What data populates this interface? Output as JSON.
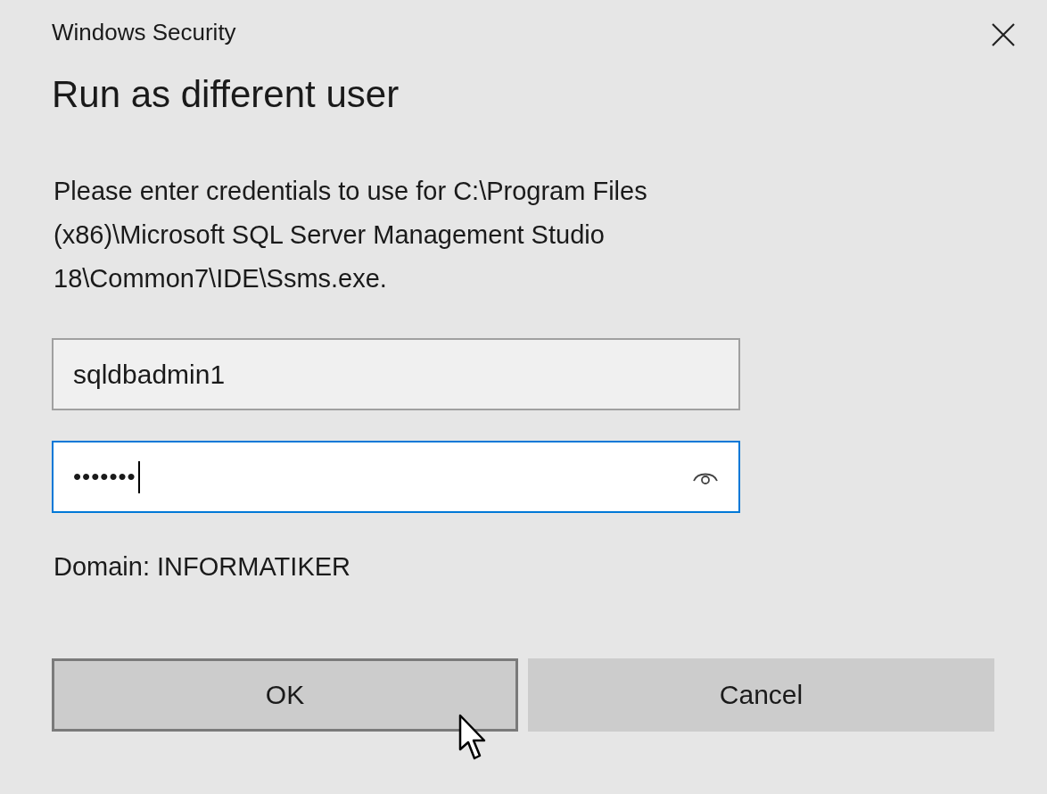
{
  "window": {
    "title": "Windows Security"
  },
  "heading": "Run as different user",
  "message": "Please enter credentials to use for C:\\Program Files (x86)\\Microsoft SQL Server Management Studio 18\\Common7\\IDE\\Ssms.exe.",
  "username": {
    "value": "sqldbadmin1",
    "focused": false
  },
  "password": {
    "value": "•••••••",
    "focused": true
  },
  "domain": "Domain: INFORMATIKER",
  "buttons": [
    {
      "label": "OK",
      "focused": true
    },
    {
      "label": "Cancel",
      "focused": false
    }
  ]
}
